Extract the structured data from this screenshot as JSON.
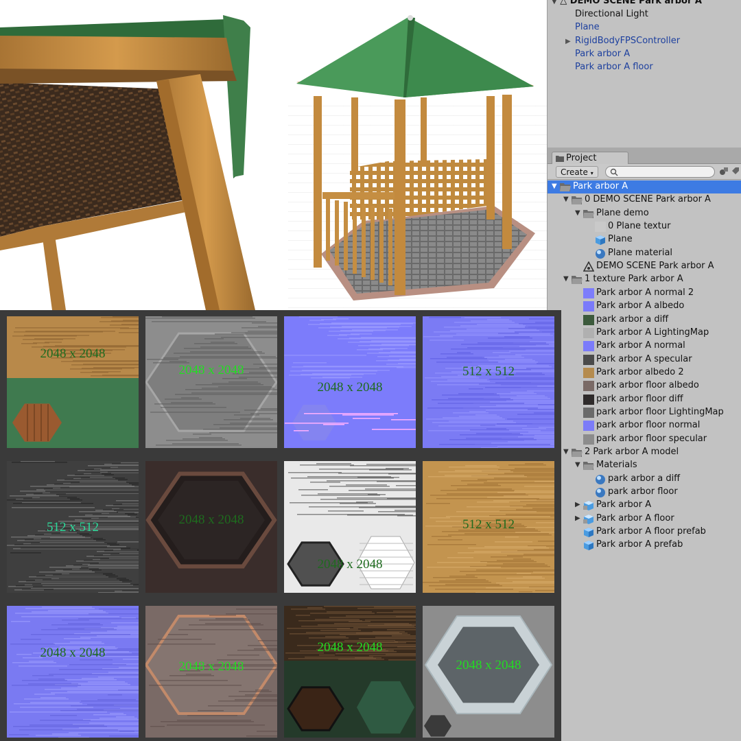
{
  "hierarchy": {
    "scene_title": "DEMO SCENE Park arbor A",
    "items": [
      {
        "label": "Directional Light",
        "color": "#111111",
        "expandable": false
      },
      {
        "label": "Plane",
        "color": "#1c3f9e",
        "expandable": false
      },
      {
        "label": "RigidBodyFPSController",
        "color": "#1c3f9e",
        "expandable": true
      },
      {
        "label": "Park arbor A",
        "color": "#1c3f9e",
        "expandable": false
      },
      {
        "label": "Park arbor A floor",
        "color": "#1c3f9e",
        "expandable": false
      }
    ]
  },
  "project": {
    "tab_label": "Project",
    "create_label": "Create",
    "search_placeholder": "",
    "tree": [
      {
        "label": "Park arbor A",
        "icon": "folder-open-icon",
        "depth": 0,
        "toggle": "open",
        "selected": true
      },
      {
        "label": "0 DEMO SCENE Park arbor A",
        "icon": "folder-open-icon",
        "depth": 1,
        "toggle": "open"
      },
      {
        "label": "Plane demo",
        "icon": "folder-open-icon",
        "depth": 2,
        "toggle": "open"
      },
      {
        "label": "0 Plane textur",
        "icon": "texture-icon",
        "depth": 3,
        "swatch": "#c9c9c9"
      },
      {
        "label": "Plane",
        "icon": "prefab-cube-icon",
        "depth": 3
      },
      {
        "label": "Plane material",
        "icon": "material-sphere-icon",
        "depth": 3
      },
      {
        "label": "DEMO SCENE Park arbor A",
        "icon": "unity-scene-icon",
        "depth": 2
      },
      {
        "label": "1 texture Park arbor A",
        "icon": "folder-open-icon",
        "depth": 1,
        "toggle": "open"
      },
      {
        "label": "Park arbor A  normal 2",
        "icon": "texture-icon",
        "depth": 2,
        "swatch": "#7d7dfb"
      },
      {
        "label": "Park arbor A albedo",
        "icon": "texture-icon",
        "depth": 2,
        "swatch": "#7a7afa"
      },
      {
        "label": "park arbor a diff",
        "icon": "texture-icon",
        "depth": 2,
        "swatch": "#3c5a3c"
      },
      {
        "label": "Park arbor A LightingMap",
        "icon": "texture-icon",
        "depth": 2,
        "swatch": "#b0b0b0"
      },
      {
        "label": "Park arbor A normal",
        "icon": "texture-icon",
        "depth": 2,
        "swatch": "#7b7bfa"
      },
      {
        "label": "Park arbor A specular",
        "icon": "texture-icon",
        "depth": 2,
        "swatch": "#4a4a4a"
      },
      {
        "label": "Park arbor albedo 2",
        "icon": "texture-icon",
        "depth": 2,
        "swatch": "#b58b4e"
      },
      {
        "label": "park arbor floor albedo",
        "icon": "texture-icon",
        "depth": 2,
        "swatch": "#7a6a66"
      },
      {
        "label": "park arbor floor diff",
        "icon": "texture-icon",
        "depth": 2,
        "swatch": "#2f2b2b"
      },
      {
        "label": "park arbor floor LightingMap",
        "icon": "texture-icon",
        "depth": 2,
        "swatch": "#6a6a6a"
      },
      {
        "label": "park arbor floor normal",
        "icon": "texture-icon",
        "depth": 2,
        "swatch": "#7c7cf8"
      },
      {
        "label": "park arbor floor specular",
        "icon": "texture-icon",
        "depth": 2,
        "swatch": "#8c8c8c"
      },
      {
        "label": "2 Park arbor A model",
        "icon": "folder-open-icon",
        "depth": 1,
        "toggle": "open"
      },
      {
        "label": "Materials",
        "icon": "folder-open-icon",
        "depth": 2,
        "toggle": "open"
      },
      {
        "label": "park arbor a diff",
        "icon": "material-sphere-icon",
        "depth": 3
      },
      {
        "label": "park arbor floor",
        "icon": "material-sphere-icon",
        "depth": 3
      },
      {
        "label": "Park arbor A",
        "icon": "model-icon",
        "depth": 2,
        "toggle": "closed"
      },
      {
        "label": "Park arbor A floor",
        "icon": "model-icon",
        "depth": 2,
        "toggle": "closed"
      },
      {
        "label": "Park arbor A floor prefab",
        "icon": "prefab-cube-icon",
        "depth": 2
      },
      {
        "label": "Park arbor A prefab",
        "icon": "prefab-cube-icon",
        "depth": 2
      }
    ]
  },
  "textures": [
    {
      "res": "2048 x 2048",
      "kind": "diffuse-wood",
      "text_color": "#1f6b1f"
    },
    {
      "res": "2048 x 2048",
      "kind": "floor-gray",
      "text_color": "#22dd22"
    },
    {
      "res": "2048 x 2048",
      "kind": "normal-atlas",
      "text_color": "#1e6b1e"
    },
    {
      "res": "512 x 512",
      "kind": "normal-plain",
      "text_color": "#1e6b1e"
    },
    {
      "res": "512 x 512",
      "kind": "specular-noise",
      "text_color": "#2bdc9b"
    },
    {
      "res": "2048 x 2048",
      "kind": "floor-dark",
      "text_color": "#1e6b1e"
    },
    {
      "res": "2048 x 2048",
      "kind": "lightmap-atlas",
      "text_color": "#1e6b1e"
    },
    {
      "res": "512 x 512",
      "kind": "wood-plain",
      "text_color": "#1e6b1e"
    },
    {
      "res": "2048 x 2048",
      "kind": "floor-normal",
      "text_color": "#1e6b1e"
    },
    {
      "res": "2048 x 2048",
      "kind": "floor-albedo",
      "text_color": "#22dd22"
    },
    {
      "res": "2048 x 2048",
      "kind": "diffuse-atlas-dark",
      "text_color": "#22dd22"
    },
    {
      "res": "2048 x 2048",
      "kind": "floor-lightmap",
      "text_color": "#22dd22"
    }
  ],
  "colors": {
    "roof_green": "#4a9a5a",
    "wood": "#c08a3e",
    "selection_blue": "#3d7be3",
    "panel_gray": "#c2c2c2"
  }
}
